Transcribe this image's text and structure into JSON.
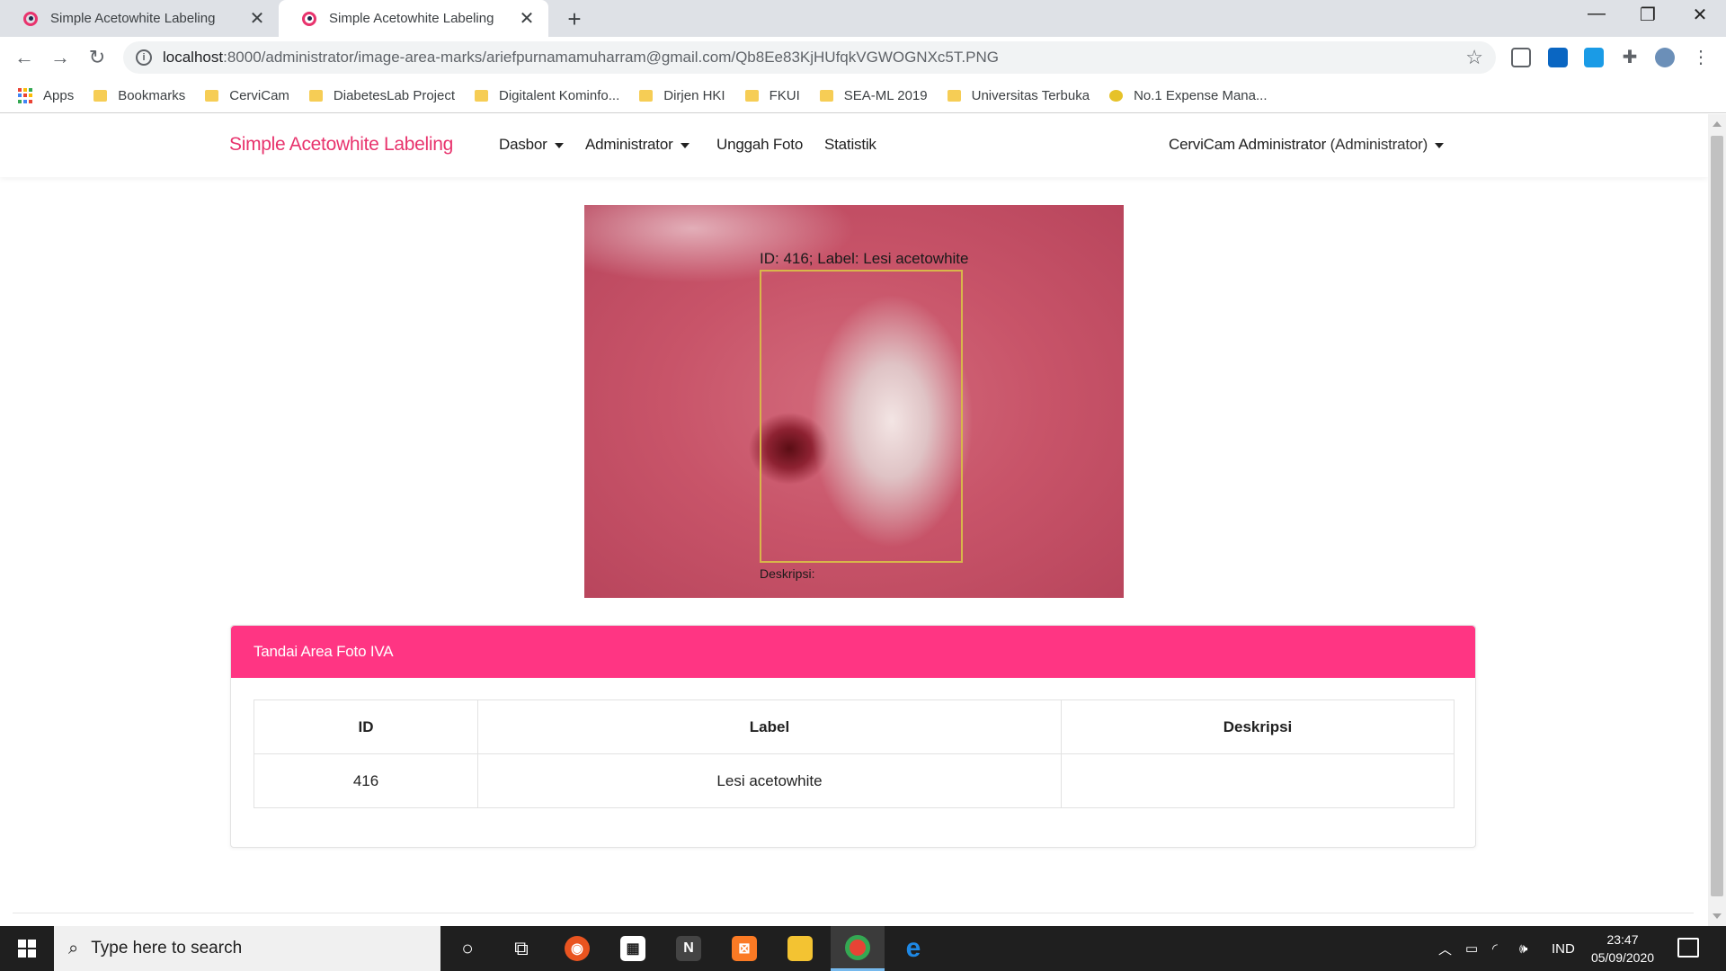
{
  "browser": {
    "tabs": [
      {
        "title": "Simple Acetowhite Labeling",
        "active": false
      },
      {
        "title": "Simple Acetowhite Labeling",
        "active": true
      }
    ],
    "url_host": "localhost",
    "url_path": ":8000/administrator/image-area-marks/ariefpurnamamuharram@gmail.com/Qb8Ee83KjHUfqkVGWOGNXc5T.PNG",
    "bookmarks": [
      "Apps",
      "Bookmarks",
      "CerviCam",
      "DiabetesLab Project",
      "Digitalent Kominfo...",
      "Dirjen HKI",
      "FKUI",
      "SEA-ML 2019",
      "Universitas Terbuka",
      "No.1 Expense Mana..."
    ]
  },
  "navbar": {
    "brand": "Simple Acetowhite Labeling",
    "links": [
      "Dasbor",
      "Administrator",
      "Unggah Foto",
      "Statistik"
    ],
    "user_name": "CerviCam Administrator",
    "user_role": "(Administrator)"
  },
  "photo": {
    "annotation_label": "ID: 416; Label: Lesi acetowhite",
    "annotation_desc": "Deskripsi:",
    "box_color": "#d8b64a"
  },
  "card": {
    "title": "Tandai Area Foto IVA",
    "header_color": "#ff3583",
    "columns": [
      "ID",
      "Label",
      "Deskripsi"
    ],
    "rows": [
      {
        "id": "416",
        "label": "Lesi acetowhite",
        "description": ""
      }
    ]
  },
  "taskbar": {
    "search_placeholder": "Type here to search",
    "language": "IND",
    "time": "23:47",
    "date": "05/09/2020"
  },
  "icons": {
    "tab_favicon": "cervicam-icon",
    "back": "back-arrow-icon",
    "forward": "forward-arrow-icon",
    "reload": "reload-icon",
    "bookmark_star": "star-icon"
  }
}
